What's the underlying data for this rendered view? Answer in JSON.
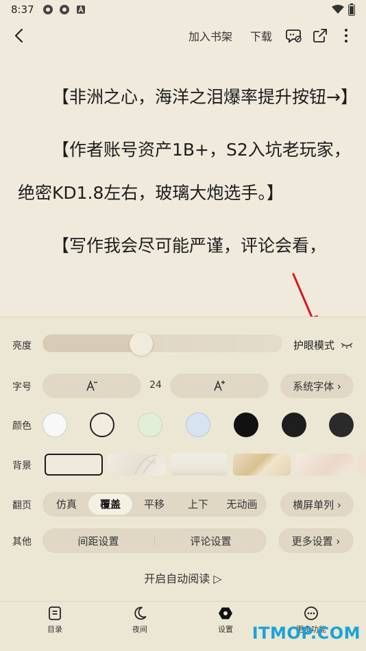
{
  "status_bar": {
    "time": "8:37"
  },
  "topbar": {
    "add_shelf": "加入书架",
    "download": "下载"
  },
  "reader": {
    "paragraphs": [
      "【非洲之心，海洋之泪爆率提升按钮→】",
      "【作者账号资产1B+，S2入坑老玩家，绝密KD1.8左右，玻璃大炮选手。】",
      "【写作我会尽可能严谨，评论会看，"
    ]
  },
  "settings": {
    "brightness": {
      "label": "亮度",
      "level_percent": 41,
      "eye_mode": "护眼模式"
    },
    "font": {
      "label": "字号",
      "size_value": "24",
      "system_font": "系统字体 ›"
    },
    "color": {
      "label": "颜色",
      "swatches": [
        "#f8f8f8",
        "#f1ecdf",
        "#e2efd8",
        "#d7e3f1",
        "#111111",
        "#1e1e1e",
        "#2a2a2a"
      ]
    },
    "background": {
      "label": "背景"
    },
    "page_turn": {
      "label": "翻页",
      "options": [
        "仿真",
        "覆盖",
        "平移",
        "上下",
        "无动画"
      ],
      "selected": "覆盖",
      "landscape": "横屏单列 ›"
    },
    "other": {
      "label": "其他",
      "spacing": "间距设置",
      "comment": "评论设置",
      "more": "更多设置 ›"
    },
    "auto_read": "开启自动阅读 ▷"
  },
  "bottom_nav": {
    "items": [
      {
        "label": "目录",
        "icon": "catalog-icon"
      },
      {
        "label": "夜间",
        "icon": "moon-icon"
      },
      {
        "label": "设置",
        "icon": "settings-hex-icon"
      },
      {
        "label": "更多功能",
        "icon": "more-dots-icon"
      }
    ]
  },
  "watermark": "ITMOP.COM"
}
